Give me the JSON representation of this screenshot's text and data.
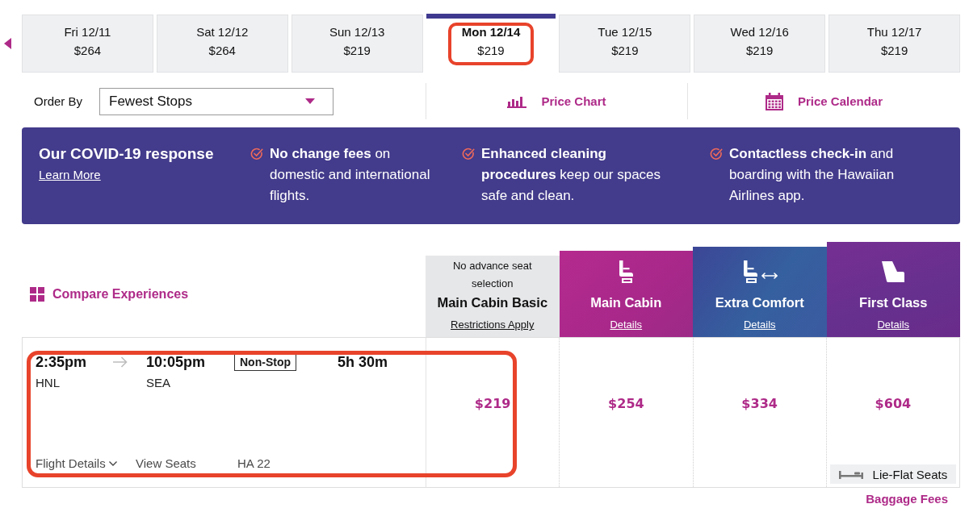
{
  "date_tabs": [
    {
      "day": "Fri 12/11",
      "price": "$264",
      "selected": false,
      "highlighted": false
    },
    {
      "day": "Sat 12/12",
      "price": "$264",
      "selected": false,
      "highlighted": false
    },
    {
      "day": "Sun 12/13",
      "price": "$219",
      "selected": false,
      "highlighted": false
    },
    {
      "day": "Mon 12/14",
      "price": "$219",
      "selected": true,
      "highlighted": true
    },
    {
      "day": "Tue 12/15",
      "price": "$219",
      "selected": false,
      "highlighted": false
    },
    {
      "day": "Wed 12/16",
      "price": "$219",
      "selected": false,
      "highlighted": false
    },
    {
      "day": "Thu 12/17",
      "price": "$219",
      "selected": false,
      "highlighted": false
    }
  ],
  "sort": {
    "label": "Order By",
    "value": "Fewest Stops"
  },
  "view_links": [
    {
      "kind": "chart",
      "label": "Price Chart"
    },
    {
      "kind": "calendar",
      "label": "Price Calendar"
    }
  ],
  "covid_banner": {
    "title": "Our COVID-19 response",
    "link": "Learn More",
    "items": [
      {
        "text": "**No change fees** on domestic and international flights."
      },
      {
        "text": "**Enhanced cleaning procedures** keep our spaces safe and clean."
      },
      {
        "text": "**Contactless check-in** and boarding with the Hawaiian Airlines app."
      }
    ]
  },
  "compare": {
    "label": "Compare Experiences"
  },
  "fare_classes": [
    {
      "kind": "basic",
      "note": "No advance seat selection",
      "name": "Main Cabin Basic",
      "link": "Restrictions Apply"
    },
    {
      "kind": "main",
      "name": "Main Cabin",
      "link": "Details"
    },
    {
      "kind": "extra",
      "name": "Extra Comfort",
      "link": "Details"
    },
    {
      "kind": "first",
      "name": "First Class",
      "link": "Details"
    }
  ],
  "flights": [
    {
      "depart_time": "2:35pm",
      "arrive_time": "10:05pm",
      "stops": "Non-Stop",
      "duration": "5h 30m",
      "origin": "HNL",
      "destination": "SEA",
      "details_link": "Flight Details",
      "seats_link": "View Seats",
      "flight_number": "HA 22",
      "highlighted": true,
      "fares": [
        {
          "price": "$219"
        },
        {
          "price": "$254"
        },
        {
          "price": "$334"
        },
        {
          "price": "$604",
          "feature": "Lie-Flat Seats"
        }
      ]
    }
  ],
  "baggage_link": "Baggage Fees"
}
